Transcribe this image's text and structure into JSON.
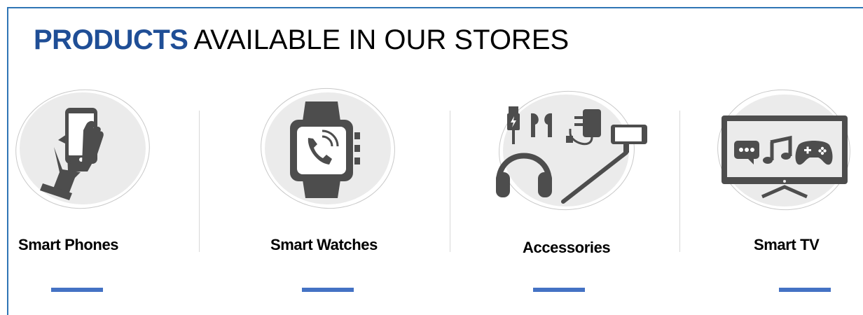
{
  "heading": {
    "emphasis": "PRODUCTS",
    "rest": "AVAILABLE IN OUR STORES"
  },
  "products": [
    {
      "label": "Smart Phones",
      "icon": "smartphone-in-hand-icon"
    },
    {
      "label": "Smart Watches",
      "icon": "smartwatch-icon"
    },
    {
      "label": "Accessories",
      "icon": "accessories-icon"
    },
    {
      "label": "Smart TV",
      "icon": "smart-tv-icon"
    }
  ],
  "colors": {
    "heading_emphasis": "#1f4e96",
    "accent_bar": "#4472c4",
    "icon": "#4d4d4d",
    "frame": "#2f75b5"
  }
}
